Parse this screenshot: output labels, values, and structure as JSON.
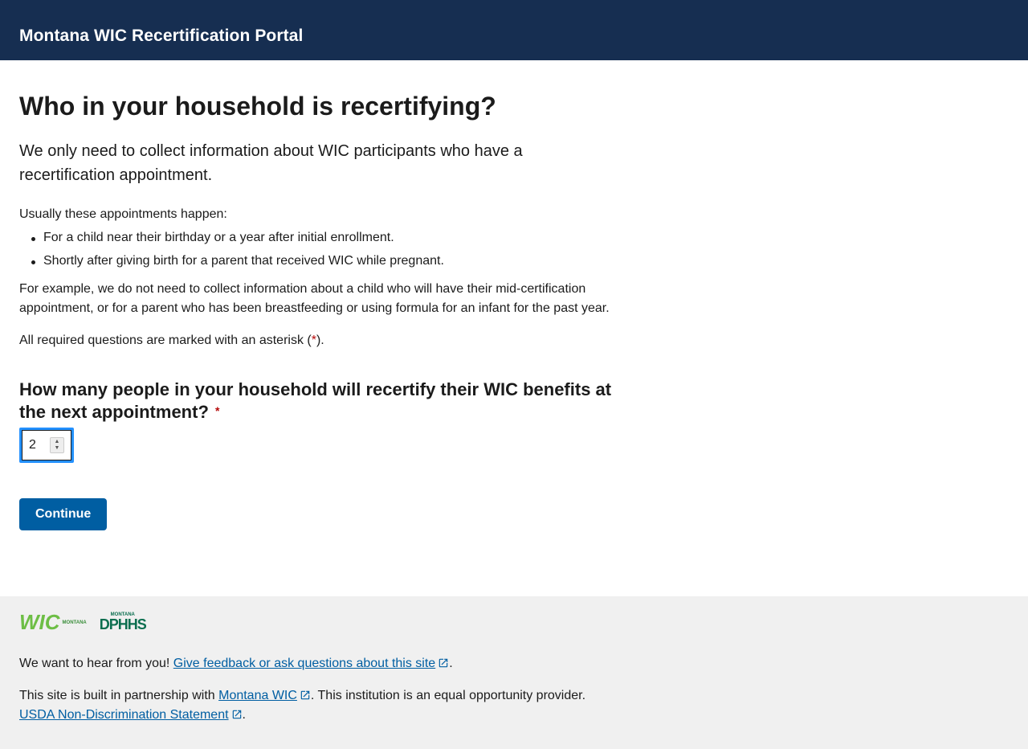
{
  "header": {
    "title": "Montana WIC Recertification Portal"
  },
  "main": {
    "heading": "Who in your household is recertifying?",
    "lede": "We only need to collect information about WIC participants who have a recertification appointment.",
    "usually_intro": "Usually these appointments happen:",
    "usually_items": [
      "For a child near their birthday or a year after initial enrollment.",
      "Shortly after giving birth for a parent that received WIC while pregnant."
    ],
    "example": "For example, we do not need to collect information about a child who will have their mid-certification appointment, or for a parent who has been breastfeeding or using formula for an infant for the past year.",
    "required_note_before": "All required questions are marked with an asterisk (",
    "required_note_mark": "*",
    "required_note_after": ").",
    "question": "How many people in your household will recertify their WIC benefits at the next appointment?",
    "question_required_mark": "*",
    "count_value": "2",
    "continue_label": "Continue"
  },
  "footer": {
    "wic_logo_text": "WIC",
    "wic_logo_sub": "MONTANA",
    "dphhs_top": "MONTANA",
    "dphhs_bottom": "DPHHS",
    "feedback_before": "We want to hear from you! ",
    "feedback_link": "Give feedback or ask questions about this site",
    "feedback_after": ".",
    "partner_before": "This site is built in partnership with ",
    "partner_link": "Montana WIC",
    "partner_after": ". This institution is an equal opportunity provider.",
    "usda_link": "USDA Non-Discrimination Statement",
    "usda_after": "."
  },
  "colors": {
    "header_bg": "#162e51",
    "button_bg": "#005ea2",
    "link": "#005ea2",
    "required": "#b50909",
    "focus": "#2491ff",
    "footer_bg": "#f0f0f0"
  },
  "icons": {
    "external_link": "external-link-icon"
  }
}
